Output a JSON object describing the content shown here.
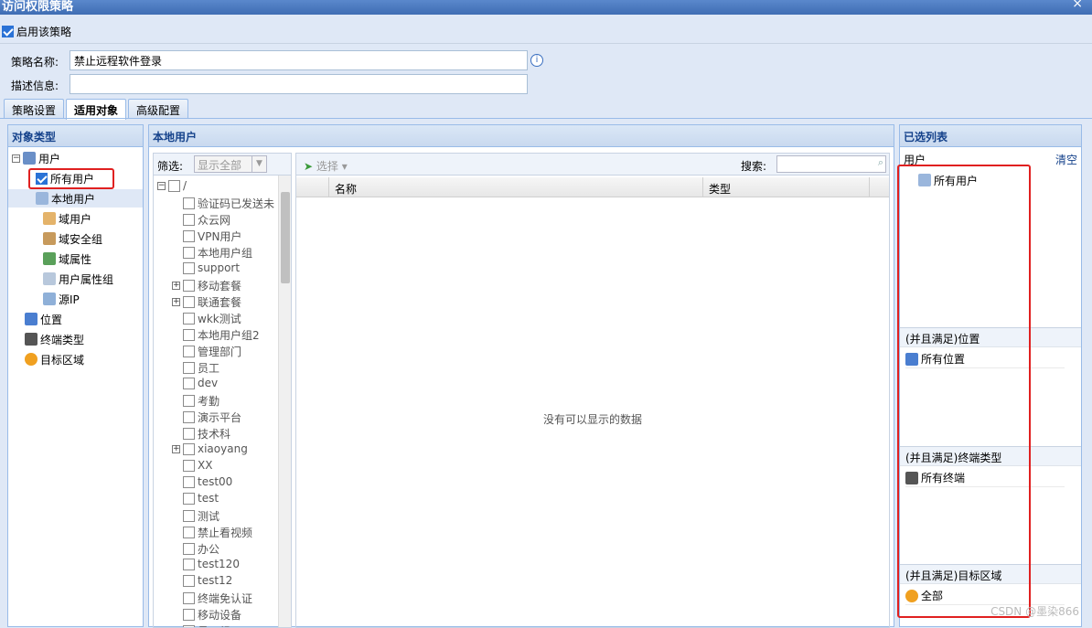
{
  "window": {
    "title": "访问权限策略",
    "close": "×"
  },
  "enable": {
    "label": "启用该策略",
    "checked": true
  },
  "form": {
    "name_label": "策略名称:",
    "name_value": "禁止远程软件登录",
    "desc_label": "描述信息:",
    "desc_value": ""
  },
  "tabs": [
    "策略设置",
    "适用对象",
    "高级配置"
  ],
  "object_type": {
    "header": "对象类型",
    "items": [
      "用户",
      "所有用户",
      "本地用户",
      "域用户",
      "域安全组",
      "域属性",
      "用户属性组",
      "源IP",
      "位置",
      "终端类型",
      "目标区域"
    ]
  },
  "local_user": {
    "header": "本地用户",
    "filter_label": "筛选:",
    "filter_value": "显示全部",
    "root": "/",
    "groups": [
      "验证码已发送未",
      "众云网",
      "VPN用户",
      "本地用户组",
      "support",
      "移动套餐",
      "联通套餐",
      "wkk测试",
      "本地用户组2",
      "管理部门",
      "员工",
      "dev",
      "考勤",
      "演示平台",
      "技术科",
      "xiaoyang",
      "XX",
      "test00",
      "test",
      "测试",
      "禁止看视频",
      "办公",
      "test120",
      "test12",
      "终端免认证",
      "移动设备",
      "员工组"
    ],
    "select_label": "选择",
    "search_label": "搜索:",
    "col_name": "名称",
    "col_type": "类型",
    "empty": "没有可以显示的数据"
  },
  "selected": {
    "header": "已选列表",
    "user_label": "用户",
    "clear": "清空",
    "user_item": "所有用户",
    "loc_header": "(并且满足)位置",
    "loc_item": "所有位置",
    "term_header": "(并且满足)终端类型",
    "term_item": "所有终端",
    "zone_header": "(并且满足)目标区域",
    "zone_item": "全部"
  },
  "watermark": "CSDN @墨染866",
  "colors": {
    "accent": "#15428b",
    "highlight": "#e02020",
    "selected_row": "#dfe8f6"
  }
}
